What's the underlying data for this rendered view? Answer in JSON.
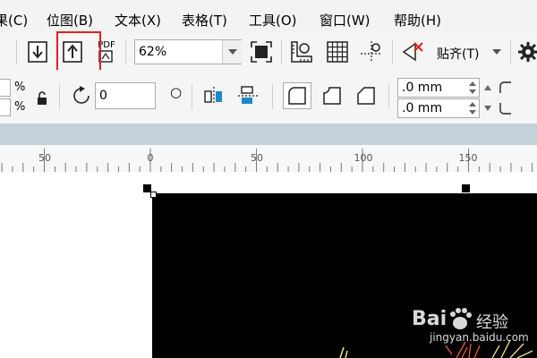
{
  "menubar": {
    "items": [
      {
        "label": "果(C)"
      },
      {
        "label": "位图(B)"
      },
      {
        "label": "文本(X)"
      },
      {
        "label": "表格(T)"
      },
      {
        "label": "工具(O)"
      },
      {
        "label": "窗口(W)"
      },
      {
        "label": "帮助(H)"
      }
    ]
  },
  "toolbar": {
    "zoom_value": "62%",
    "snap_label": "贴齐(T)",
    "pdf_label": "PDF"
  },
  "propbar": {
    "percent_symbol": "%",
    "rotation_value": "0",
    "corner_value_1": ".0 mm",
    "corner_value_2": ".0 mm"
  },
  "ruler": {
    "ticks": [
      "50",
      "0",
      "50",
      "100",
      "150"
    ]
  },
  "watermark": {
    "brand": "Bai",
    "brand2": "经验",
    "url": "jingyan.baidu.com"
  },
  "annotation": {
    "color": "#e02020"
  }
}
